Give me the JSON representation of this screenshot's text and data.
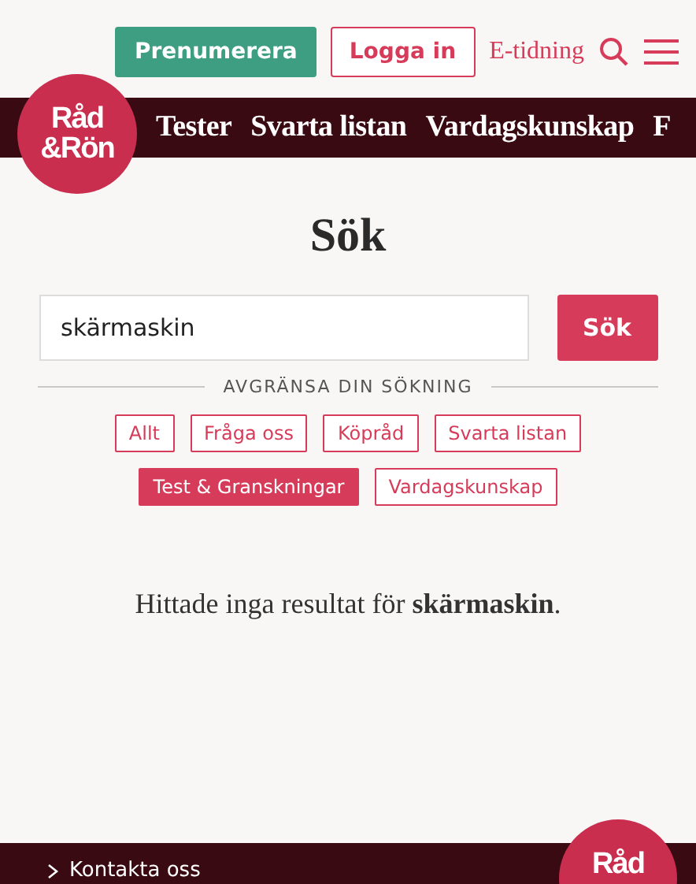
{
  "header": {
    "subscribe": "Prenumerera",
    "login": "Logga in",
    "e_paper": "E-tidning"
  },
  "logo": {
    "lines": [
      "Råd",
      "&Rön"
    ]
  },
  "nav": [
    "Tester",
    "Svarta listan",
    "Vardagskunskap",
    "F"
  ],
  "page_title": "Sök",
  "search": {
    "value": "skärmaskin",
    "button": "Sök"
  },
  "filter_heading": "AVGRÄNSA DIN SÖKNING",
  "filters": [
    {
      "label": "Allt",
      "selected": false
    },
    {
      "label": "Fråga oss",
      "selected": false
    },
    {
      "label": "Köpråd",
      "selected": false
    },
    {
      "label": "Svarta listan",
      "selected": false
    },
    {
      "label": "Test & Granskningar",
      "selected": true
    },
    {
      "label": "Vardagskunskap",
      "selected": false
    }
  ],
  "result_message": "Hittade inga resultat för **skärmaskin**.",
  "footer": {
    "link": "Kontakta oss",
    "logo_lines": [
      "Råd"
    ]
  }
}
